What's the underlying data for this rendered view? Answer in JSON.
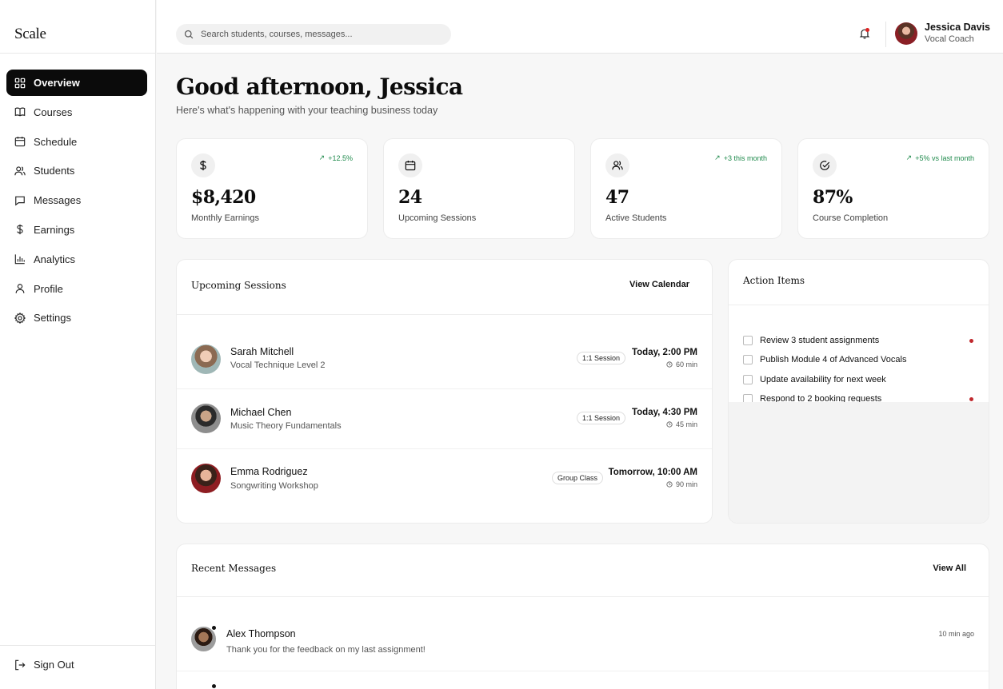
{
  "brand": "Scale",
  "sidebar": {
    "items": [
      {
        "label": "Overview",
        "icon": "grid-icon",
        "active": true
      },
      {
        "label": "Courses",
        "icon": "book-icon"
      },
      {
        "label": "Schedule",
        "icon": "calendar-icon"
      },
      {
        "label": "Students",
        "icon": "users-icon"
      },
      {
        "label": "Messages",
        "icon": "message-icon"
      },
      {
        "label": "Earnings",
        "icon": "dollar-icon"
      },
      {
        "label": "Analytics",
        "icon": "bar-chart-icon"
      },
      {
        "label": "Profile",
        "icon": "user-icon"
      },
      {
        "label": "Settings",
        "icon": "gear-icon"
      }
    ],
    "sign_out": "Sign Out"
  },
  "header": {
    "search_placeholder": "Search students, courses, messages...",
    "user_name": "Jessica Davis",
    "user_role": "Vocal Coach",
    "notification_dot_color": "#dd2222"
  },
  "greeting": {
    "title": "Good afternoon, Jessica",
    "subtitle": "Here's what's happening with your teaching business today"
  },
  "stats": [
    {
      "icon": "dollar-icon",
      "value": "$8,420",
      "label": "Monthly Earnings",
      "trend": "+12.5%"
    },
    {
      "icon": "calendar-icon",
      "value": "24",
      "label": "Upcoming Sessions",
      "trend": ""
    },
    {
      "icon": "users-icon",
      "value": "47",
      "label": "Active Students",
      "trend": "+3 this month"
    },
    {
      "icon": "check-circle-icon",
      "value": "87%",
      "label": "Course Completion",
      "trend": "+5% vs last month"
    }
  ],
  "sessions": {
    "title": "Upcoming Sessions",
    "link": "View Calendar",
    "items": [
      {
        "name": "Sarah Mitchell",
        "course": "Vocal Technique Level 2",
        "type": "1:1 Session",
        "time": "Today, 2:00 PM",
        "duration": "60 min"
      },
      {
        "name": "Michael Chen",
        "course": "Music Theory Fundamentals",
        "type": "1:1 Session",
        "time": "Today, 4:30 PM",
        "duration": "45 min"
      },
      {
        "name": "Emma Rodriguez",
        "course": "Songwriting Workshop",
        "type": "Group Class",
        "time": "Tomorrow, 10:00 AM",
        "duration": "90 min"
      }
    ]
  },
  "action_items": {
    "title": "Action Items",
    "items": [
      {
        "label": "Review 3 student assignments",
        "urgent": true
      },
      {
        "label": "Publish Module 4 of Advanced Vocals",
        "urgent": false
      },
      {
        "label": "Update availability for next week",
        "urgent": false
      },
      {
        "label": "Respond to 2 booking requests",
        "urgent": true
      }
    ],
    "urgent_color": "#c0282d"
  },
  "messages": {
    "title": "Recent Messages",
    "link": "View All",
    "items": [
      {
        "name": "Alex Thompson",
        "text": "Thank you for the feedback on my last assignment!",
        "time": "10 min ago"
      }
    ]
  },
  "colors": {
    "accent": "#0b0b0b",
    "trend_green": "#1f8a4c",
    "background": "#f7f7f7"
  }
}
